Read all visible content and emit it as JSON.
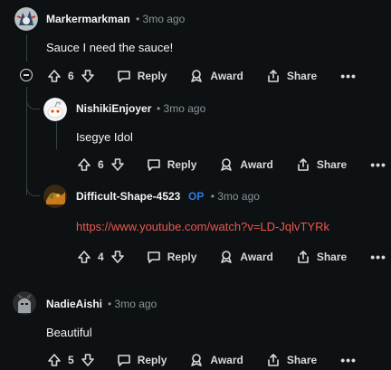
{
  "comments": [
    {
      "username": "Markermarkman",
      "time": "3mo ago",
      "body": "Sauce I need the sauce!",
      "votes": "6",
      "reply_label": "Reply",
      "award_label": "Award",
      "share_label": "Share"
    },
    {
      "username": "NishikiEnjoyer",
      "time": "3mo ago",
      "body": "Isegye Idol",
      "votes": "6",
      "reply_label": "Reply",
      "award_label": "Award",
      "share_label": "Share"
    },
    {
      "username": "Difficult-Shape-4523",
      "op_badge": "OP",
      "time": "3mo ago",
      "body": "https://www.youtube.com/watch?v=LD-JqlvTYRk",
      "votes": "4",
      "reply_label": "Reply",
      "award_label": "Award",
      "share_label": "Share"
    },
    {
      "username": "NadieAishi",
      "time": "3mo ago",
      "body": "Beautiful",
      "votes": "5",
      "reply_label": "Reply",
      "award_label": "Award",
      "share_label": "Share"
    }
  ],
  "meta_separator": "•",
  "more_label": "•••",
  "icons": [
    "upvote-icon",
    "downvote-icon",
    "reply-icon",
    "award-icon",
    "share-icon",
    "collapse-icon"
  ],
  "colors": {
    "background": "#0e1113",
    "link": "#e8584d",
    "op": "#2f7be0",
    "meta": "#8b9396"
  }
}
